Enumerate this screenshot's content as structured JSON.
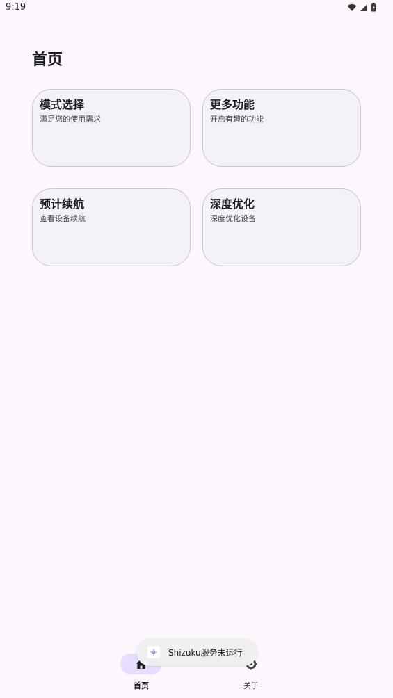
{
  "status_bar": {
    "time": "9:19",
    "icons": [
      "wifi-icon",
      "cellular-signal-icon",
      "battery-charging-icon"
    ]
  },
  "page": {
    "title": "首页"
  },
  "cards": [
    {
      "title": "模式选择",
      "subtitle": "满足您的使用需求"
    },
    {
      "title": "更多功能",
      "subtitle": "开启有趣的功能"
    },
    {
      "title": "预计续航",
      "subtitle": "查看设备续航"
    },
    {
      "title": "深度优化",
      "subtitle": "深度优化设备"
    }
  ],
  "bottom_nav": {
    "items": [
      {
        "label": "首页",
        "icon": "home-icon",
        "selected": true
      },
      {
        "label": "关于",
        "icon": "settings-icon",
        "selected": false
      }
    ]
  },
  "toast": {
    "icon": "shizuku-icon",
    "text": "Shizuku服务未运行"
  },
  "colors": {
    "background": "#fdf7fd",
    "card_background": "#f5f2f7",
    "card_border": "#c9c4cb",
    "nav_indicator": "#e9ddff",
    "toast_background": "#efeff0"
  }
}
